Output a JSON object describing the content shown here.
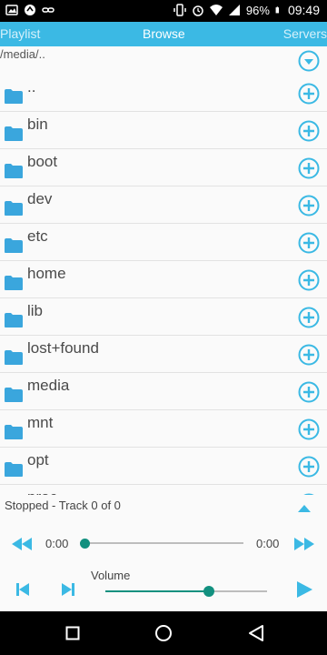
{
  "status_bar": {
    "battery": "96%",
    "time": "09:49"
  },
  "tabs": {
    "playlist": "Playlist",
    "browse": "Browse",
    "servers": "Servers"
  },
  "browse": {
    "path": "/media/..",
    "items": [
      {
        "name": ".."
      },
      {
        "name": "bin"
      },
      {
        "name": "boot"
      },
      {
        "name": "dev"
      },
      {
        "name": "etc"
      },
      {
        "name": "home"
      },
      {
        "name": "lib"
      },
      {
        "name": "lost+found"
      },
      {
        "name": "media"
      },
      {
        "name": "mnt"
      },
      {
        "name": "opt"
      },
      {
        "name": "proc"
      }
    ]
  },
  "player": {
    "status": "Stopped - Track 0 of 0",
    "time_elapsed": "0:00",
    "time_total": "0:00",
    "seek_fraction": 0.0,
    "volume_label": "Volume",
    "volume_fraction": 0.64
  },
  "colors": {
    "accent": "#3bb9e4",
    "slider": "#12907f",
    "folder": "#3aa6dd"
  }
}
